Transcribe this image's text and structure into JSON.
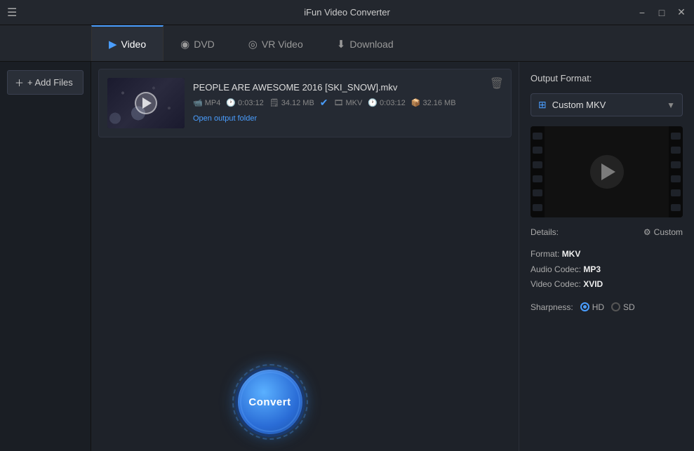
{
  "app": {
    "title": "iFun Video Converter"
  },
  "title_bar": {
    "menu_icon": "☰",
    "controls": {
      "minimize": "−",
      "maximize": "□",
      "close": "✕"
    }
  },
  "tabs": [
    {
      "id": "video",
      "label": "Video",
      "icon": "🎬",
      "active": true
    },
    {
      "id": "dvd",
      "label": "DVD",
      "icon": "💿",
      "active": false
    },
    {
      "id": "vr-video",
      "label": "VR Video",
      "icon": "🥽",
      "active": false
    },
    {
      "id": "download",
      "label": "Download",
      "icon": "⬇",
      "active": false
    }
  ],
  "sidebar": {
    "add_files_label": "+ Add Files"
  },
  "file_item": {
    "name": "PEOPLE ARE AWESOME 2016 [SKI_SNOW].mkv",
    "source_format": "MP4",
    "source_duration": "0:03:12",
    "source_size": "34.12 MB",
    "output_format": "MKV",
    "output_duration": "0:03:12",
    "output_size": "32.16 MB",
    "open_folder_label": "Open output folder"
  },
  "right_panel": {
    "output_format_label": "Output Format:",
    "selected_format": "Custom MKV",
    "details_label": "Details:",
    "custom_label": "Custom",
    "format": {
      "label": "Format:",
      "value": "MKV"
    },
    "audio_codec": {
      "label": "Audio Codec:",
      "value": "MP3"
    },
    "video_codec": {
      "label": "Video Codec:",
      "value": "XVID"
    },
    "sharpness": {
      "label": "Sharpness:",
      "options": [
        "HD",
        "SD"
      ],
      "selected": "HD"
    }
  },
  "convert_button": {
    "label": "Convert"
  }
}
